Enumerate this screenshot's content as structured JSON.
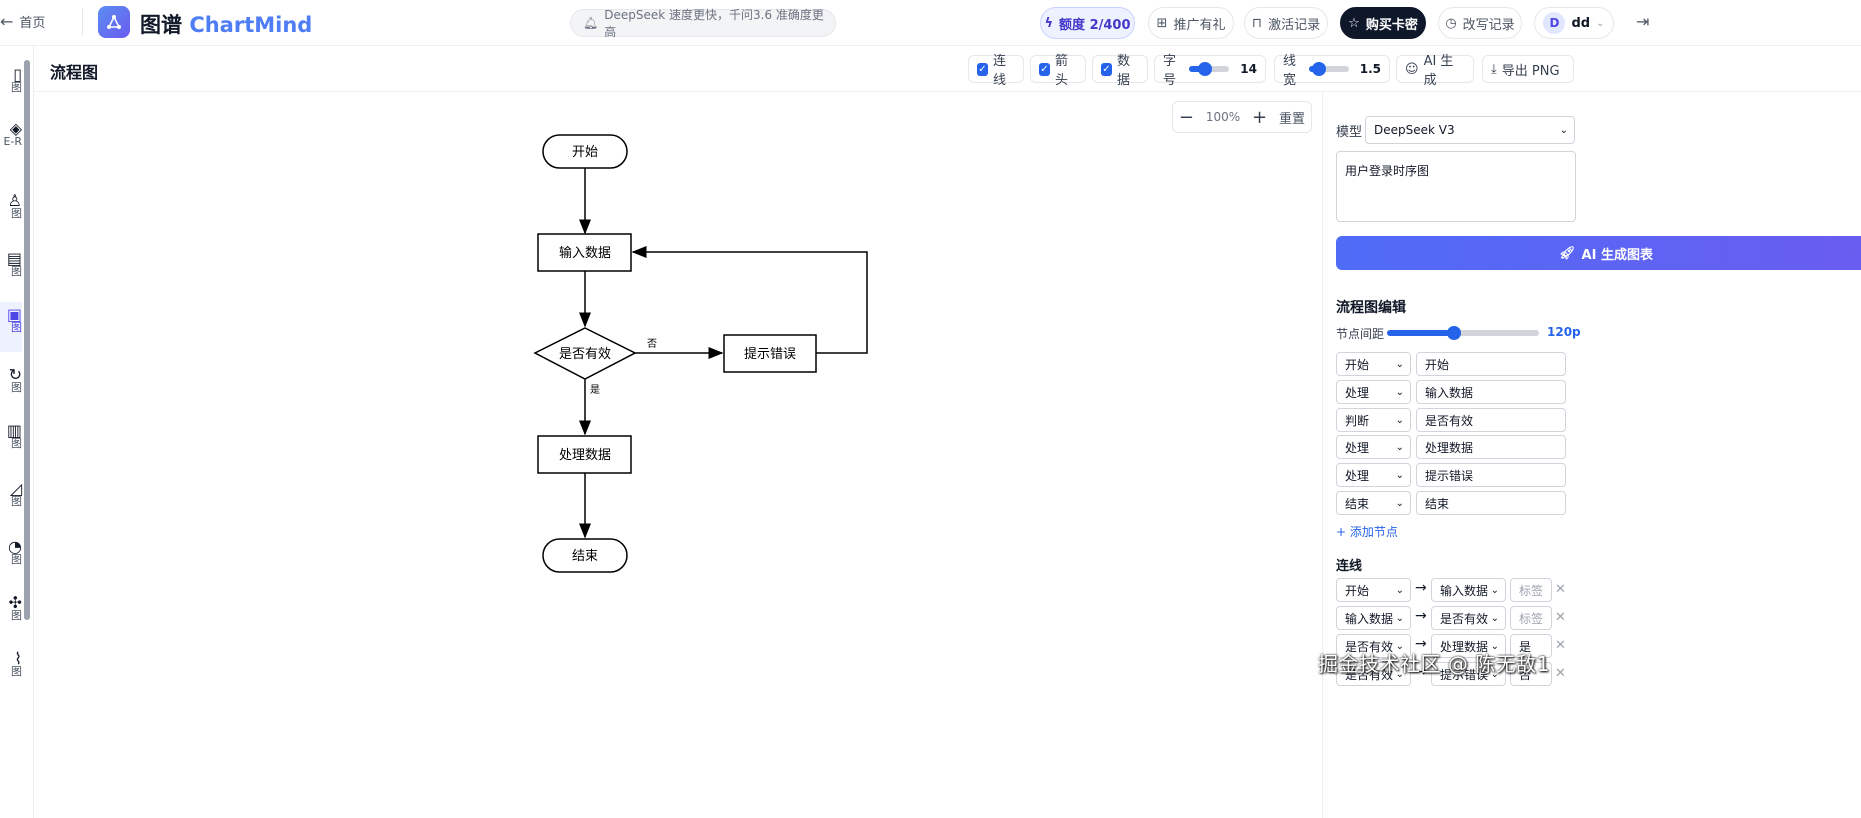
{
  "topbar": {
    "home": "首页",
    "brand_cn": "图谱",
    "brand_en": "ChartMind",
    "notice": "DeepSeek 速度更快，千问3.6 准确度更高",
    "quota": "额度 2/400",
    "promo": "推广有礼",
    "activation": "激活记录",
    "buy": "购买卡密",
    "rewrite": "改写记录",
    "avatar_initial": "D",
    "username": "dd"
  },
  "rail": {
    "items": [
      {
        "label": "图"
      },
      {
        "label": "E-R"
      },
      {
        "label": "图"
      },
      {
        "label": "图"
      },
      {
        "label": "图"
      },
      {
        "label": "图"
      },
      {
        "label": "图"
      },
      {
        "label": "图"
      },
      {
        "label": "图"
      },
      {
        "label": "图"
      },
      {
        "label": "图"
      }
    ]
  },
  "toolbar": {
    "title": "流程图",
    "edges_label": "连线",
    "arrows_label": "箭头",
    "data_label": "数据",
    "font_size_label": "字号",
    "font_size_value": "14",
    "font_size_fraction": 0.4,
    "line_width_label": "线宽",
    "line_width_value": "1.5",
    "line_width_fraction": 0.25,
    "ai_generate": "AI 生成",
    "export_png": "导出 PNG"
  },
  "canvas": {
    "zoom_minus": "−",
    "zoom_level": "100%",
    "zoom_plus": "+",
    "reset": "重置",
    "nodes": {
      "start": "开始",
      "input": "输入数据",
      "decision": "是否有效",
      "error": "提示错误",
      "process": "处理数据",
      "end": "结束"
    },
    "edge_labels": {
      "no": "否",
      "yes": "是"
    }
  },
  "panel": {
    "model_label": "模型",
    "model_value": "DeepSeek V3",
    "prompt_value": "用户登录时序图",
    "generate_button": "AI 生成图表",
    "editor_heading": "流程图编辑",
    "spacing_label": "节点间距",
    "spacing_value": "120p",
    "spacing_fraction": 0.44,
    "nodes": [
      {
        "type": "开始",
        "text": "开始"
      },
      {
        "type": "处理",
        "text": "输入数据"
      },
      {
        "type": "判断",
        "text": "是否有效"
      },
      {
        "type": "处理",
        "text": "处理数据"
      },
      {
        "type": "处理",
        "text": "提示错误"
      },
      {
        "type": "结束",
        "text": "结束"
      }
    ],
    "add_node": "+ 添加节点",
    "edges_heading": "连线",
    "edges": [
      {
        "from": "开始",
        "to": "输入数据",
        "label": "",
        "placeholder": "标签"
      },
      {
        "from": "输入数据",
        "to": "是否有效",
        "label": "",
        "placeholder": "标签"
      },
      {
        "from": "是否有效",
        "to": "处理数据",
        "label": "是",
        "placeholder": "标签"
      },
      {
        "from": "是否有效",
        "to": "提示错误",
        "label": "否",
        "placeholder": "标签"
      }
    ]
  },
  "watermark": "掘金技术社区 @ 陈无敌1"
}
